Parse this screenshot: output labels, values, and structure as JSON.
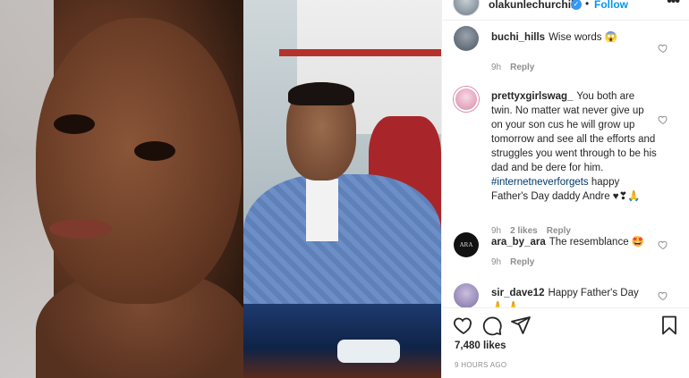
{
  "post": {
    "username": "olakunlechurchill",
    "follow_label": "Follow",
    "separator": "•",
    "more_label": "•••"
  },
  "comments": [
    {
      "username": "buchi_hills",
      "text": "Wise words 😱",
      "time": "9h",
      "likes": "",
      "reply": "Reply",
      "avatar_color": "#4a5563"
    },
    {
      "username": "prettyxgirlswag_",
      "text": "You both are twin. No matter wat never give up on your son cus he will grow up tomorrow and see all the efforts and struggles you went through to be his dad and be dere for him.",
      "hashtag": "#internetneverforgets",
      "text_after": "happy Father's Day daddy Andre ♥❣🙏",
      "time": "9h",
      "likes": "2 likes",
      "reply": "Reply",
      "avatar_color": "#e8b4c8"
    },
    {
      "username": "ara_by_ara",
      "text": "The resemblance 🤩",
      "time": "9h",
      "likes": "",
      "reply": "Reply",
      "avatar_color": "#111111",
      "avatar_text": "ARA"
    },
    {
      "username": "sir_dave12",
      "text": "Happy Father's Day🙏 🙏",
      "time": "",
      "likes": "",
      "reply": "",
      "avatar_color": "#7d6fa0"
    }
  ],
  "actions": {
    "likes": "7,480 likes",
    "timestamp": "9 HOURS AGO"
  },
  "icons": [
    "heart-icon",
    "comment-icon",
    "share-icon",
    "bookmark-icon",
    "verified-icon",
    "more-icon"
  ],
  "colors": {
    "link_blue": "#0095f6",
    "hashtag_blue": "#00376b",
    "muted": "#8e8e8e",
    "text": "#262626"
  }
}
